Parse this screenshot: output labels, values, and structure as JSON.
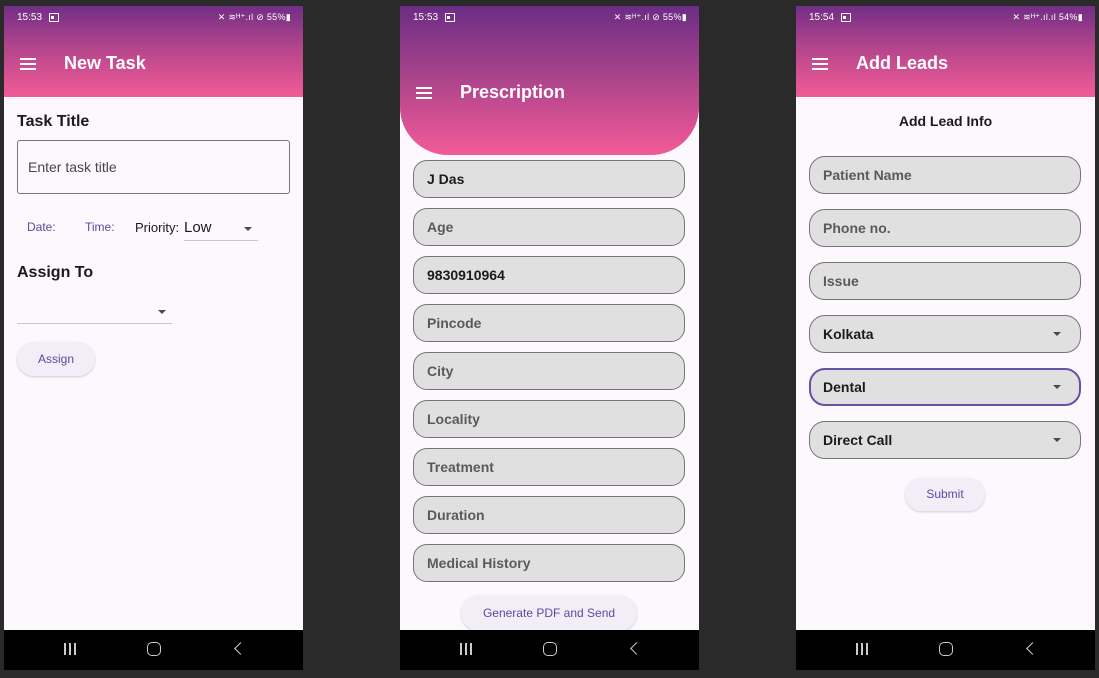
{
  "screens": {
    "new_task": {
      "status_time": "15:53",
      "status_icons": "✕ ≋ᴴ⁺.ıl ⊘ 55%▮",
      "title": "New Task",
      "task_title_label": "Task Title",
      "task_title_placeholder": "Enter task title",
      "date_label": "Date:",
      "time_label": "Time:",
      "priority_label": "Priority:",
      "priority_value": "Low",
      "assign_to_label": "Assign To",
      "assign_button": "Assign"
    },
    "prescription": {
      "status_time": "15:53",
      "status_icons": "✕ ≋ᴴ⁺.ıl ⊘ 55%▮",
      "title": "Prescription",
      "fields": [
        {
          "text": "J Das",
          "filled": true
        },
        {
          "text": "Age",
          "filled": false
        },
        {
          "text": "9830910964",
          "filled": true
        },
        {
          "text": "Pincode",
          "filled": false
        },
        {
          "text": "City",
          "filled": false
        },
        {
          "text": "Locality",
          "filled": false
        },
        {
          "text": "Treatment",
          "filled": false
        },
        {
          "text": "Duration",
          "filled": false
        },
        {
          "text": "Medical History",
          "filled": false
        }
      ],
      "generate_button": "Generate PDF and Send"
    },
    "add_leads": {
      "status_time": "15:54",
      "status_icons": "✕ ≋ᴴ⁺.ıl.ıl 54%▮",
      "title": "Add Leads",
      "heading": "Add Lead Info",
      "patient_name_placeholder": "Patient Name",
      "phone_placeholder": "Phone no.",
      "issue_placeholder": "Issue",
      "city_value": "Kolkata",
      "department_value": "Dental",
      "source_value": "Direct Call",
      "submit_button": "Submit"
    }
  },
  "colors": {
    "header_top": "#722e86",
    "header_bottom": "#f25b96",
    "accent": "#5b4b9f",
    "field_bg": "#e0e0e0",
    "focus_border": "#6750a4"
  }
}
